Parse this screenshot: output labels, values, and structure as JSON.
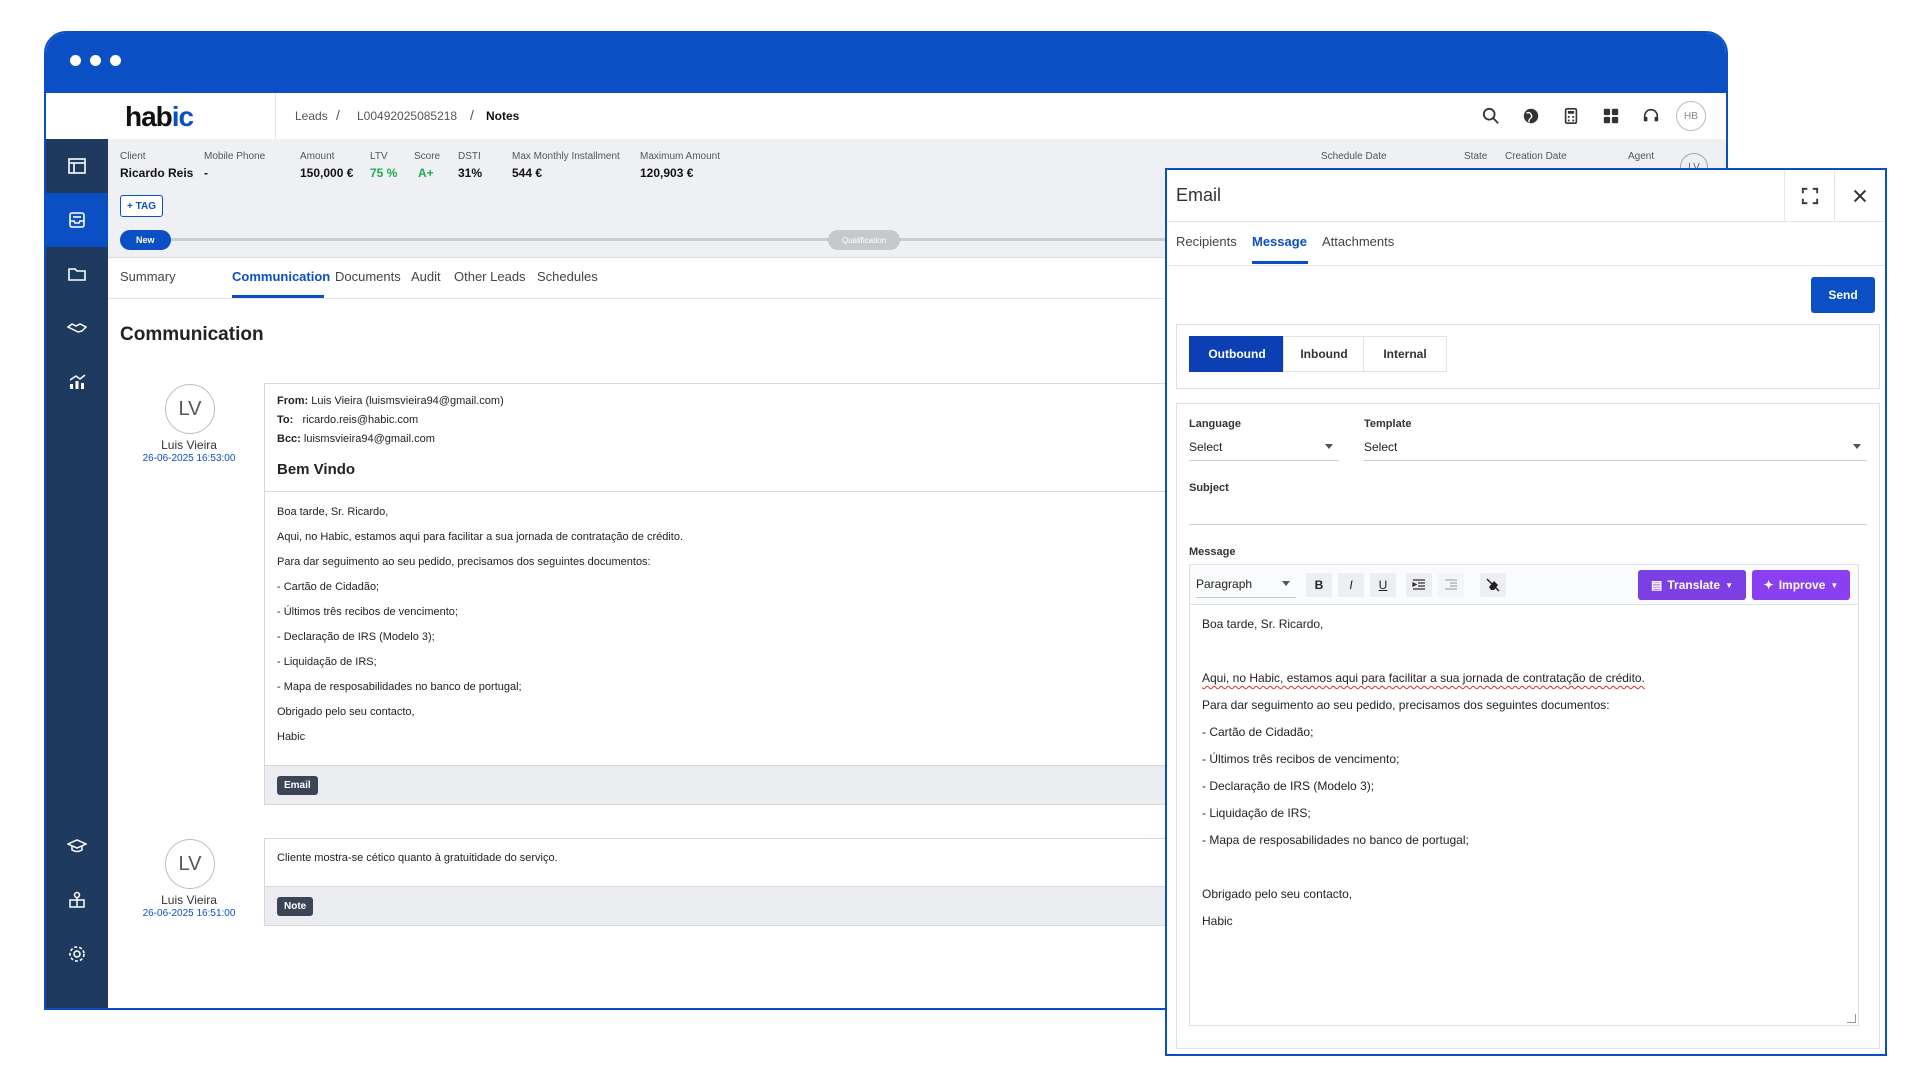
{
  "app": {
    "logo_text": "hab",
    "logo_accent": "ic",
    "brand_color": "#0b4fc4",
    "breadcrumb": [
      "Leads",
      "L00492025085218",
      "Notes"
    ],
    "breadcrumb_sep": "/",
    "user_initials": "HB"
  },
  "sidebar": {
    "items": [
      {
        "icon": "dashboard-icon"
      },
      {
        "icon": "leads-inbox-icon",
        "active": true
      },
      {
        "icon": "folder-icon"
      },
      {
        "icon": "handshake-icon"
      },
      {
        "icon": "analytics-icon"
      },
      {
        "icon": "graduation-cap-icon"
      },
      {
        "icon": "network-icon"
      },
      {
        "icon": "gear-icon"
      }
    ]
  },
  "header_icons": [
    "search-icon",
    "globe-icon",
    "calculator-icon",
    "apps-grid-icon",
    "support-headset-icon"
  ],
  "lead_info": {
    "client_label": "Client",
    "client": "Ricardo Reis",
    "phone_label": "Mobile Phone",
    "phone": "-",
    "amount_label": "Amount",
    "amount": "150,000 €",
    "ltv_label": "LTV",
    "ltv": "75 %",
    "score_label": "Score",
    "score": "A+",
    "dsti_label": "DSTI",
    "dsti": "31%",
    "max_installment_label": "Max Monthly Installment",
    "max_installment": "544 €",
    "max_amount_label": "Maximum Amount",
    "max_amount": "120,903 €",
    "schedule_label": "Schedule Date",
    "state_label": "State",
    "creation_label": "Creation Date",
    "agent_label": "Agent",
    "agent_initials": "LV",
    "tag_button": "+ TAG"
  },
  "pipeline": {
    "current": "New",
    "next": "Qualification"
  },
  "tabs": [
    "Summary",
    "Communication",
    "Documents",
    "Audit",
    "Other Leads",
    "Schedules"
  ],
  "section_title": "Communication",
  "timeline": [
    {
      "initials": "LV",
      "author": "Luis Vieira",
      "date": "26-06-2025 16:53:00",
      "from_label": "From:",
      "from": "Luis Vieira (luismsvieira94@gmail.com)",
      "to_label": "To:",
      "to": "ricardo.reis@habic.com",
      "bcc_label": "Bcc:",
      "bcc": "luismsvieira94@gmail.com",
      "subject": "Bem Vindo",
      "lines": [
        "Boa tarde, Sr. Ricardo,",
        "Aqui, no Habic, estamos aqui para facilitar a sua jornada de contratação de crédito.",
        "Para dar seguimento ao seu pedido, precisamos dos seguintes documentos:",
        "- Cartão de Cidadão;",
        "- Últimos três recibos de vencimento;",
        "- Declaração de IRS (Modelo 3);",
        "- Liquidação de IRS;",
        "- Mapa de resposabilidades no banco de portugal;",
        "Obrigado pelo seu contacto,",
        "Habic"
      ],
      "badge": "Email"
    },
    {
      "initials": "LV",
      "author": "Luis Vieira",
      "date": "26-06-2025 16:51:00",
      "text": "Cliente mostra-se cético quanto à gratuitidade do serviço.",
      "badge": "Note"
    }
  ],
  "email_modal": {
    "title": "Email",
    "tabs": [
      "Recipients",
      "Message",
      "Attachments"
    ],
    "send_label": "Send",
    "direction": [
      "Outbound",
      "Inbound",
      "Internal"
    ],
    "language_label": "Language",
    "language_value": "Select",
    "template_label": "Template",
    "template_value": "Select",
    "subject_label": "Subject",
    "subject_value": "",
    "message_label": "Message",
    "paragraph_select": "Paragraph",
    "format_buttons": [
      "B",
      "I",
      "U"
    ],
    "translate_label": "Translate",
    "improve_label": "Improve",
    "translate_color": "#7b3fe4",
    "improve_color": "#8a3ff0",
    "body_lines": [
      "Boa tarde, Sr. Ricardo,",
      "",
      "Aqui, no Habic, estamos aqui para facilitar a sua jornada de contratação de crédito.",
      "Para dar seguimento ao seu pedido, precisamos dos seguintes documentos:",
      "- Cartão de Cidadão;",
      "- Últimos três recibos de vencimento;",
      "- Declaração de IRS (Modelo 3);",
      "- Liquidação de IRS;",
      "- Mapa de resposabilidades no banco de portugal;",
      "",
      "Obrigado pelo seu contacto,",
      "Habic"
    ]
  }
}
